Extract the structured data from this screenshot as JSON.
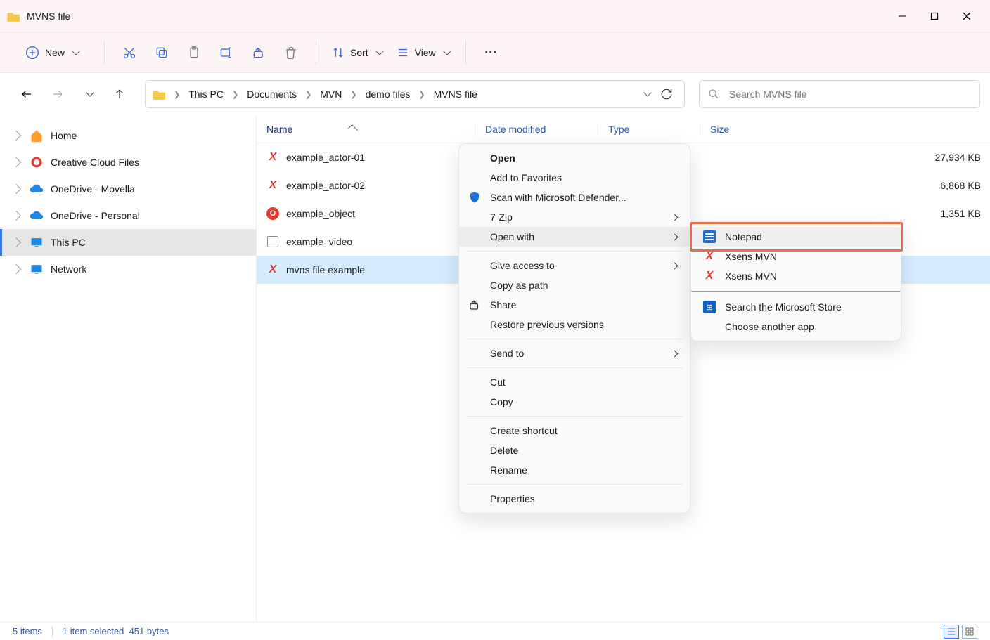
{
  "window": {
    "title": "MVNS file"
  },
  "toolbar": {
    "new_label": "New",
    "sort_label": "Sort",
    "view_label": "View"
  },
  "breadcrumbs": [
    "This PC",
    "Documents",
    "MVN",
    "demo files",
    "MVNS file"
  ],
  "search": {
    "placeholder": "Search MVNS file"
  },
  "tree": {
    "items": [
      {
        "label": "Home",
        "icon": "home"
      },
      {
        "label": "Creative Cloud Files",
        "icon": "cc"
      },
      {
        "label": "OneDrive - Movella",
        "icon": "cloud"
      },
      {
        "label": "OneDrive - Personal",
        "icon": "cloud"
      },
      {
        "label": "This PC",
        "icon": "pc",
        "selected": true
      },
      {
        "label": "Network",
        "icon": "net"
      }
    ]
  },
  "columns": {
    "name": "Name",
    "date": "Date modified",
    "type": "Type",
    "size": "Size"
  },
  "files": [
    {
      "name": "example_actor-01",
      "icon": "x",
      "size": "27,934 KB"
    },
    {
      "name": "example_actor-02",
      "icon": "x",
      "size": "6,868 KB"
    },
    {
      "name": "example_object",
      "icon": "o",
      "size": "1,351 KB"
    },
    {
      "name": "example_video",
      "icon": "v",
      "size": ""
    },
    {
      "name": "mvns file example",
      "icon": "x",
      "size": "",
      "selected": true
    }
  ],
  "context_menu": {
    "items": [
      {
        "label": "Open",
        "bold": true
      },
      {
        "label": "Add to Favorites"
      },
      {
        "label": "Scan with Microsoft Defender...",
        "icon": "shield"
      },
      {
        "label": "7-Zip",
        "arrow": true
      },
      {
        "label": "Open with",
        "arrow": true,
        "highlight": true
      },
      {
        "sep": true
      },
      {
        "label": "Give access to",
        "arrow": true
      },
      {
        "label": "Copy as path"
      },
      {
        "label": "Share",
        "icon": "share"
      },
      {
        "label": "Restore previous versions"
      },
      {
        "sep": true
      },
      {
        "label": "Send to",
        "arrow": true
      },
      {
        "sep": true
      },
      {
        "label": "Cut"
      },
      {
        "label": "Copy"
      },
      {
        "sep": true
      },
      {
        "label": "Create shortcut"
      },
      {
        "label": "Delete"
      },
      {
        "label": "Rename"
      },
      {
        "sep": true
      },
      {
        "label": "Properties"
      }
    ]
  },
  "openwith_menu": {
    "items": [
      {
        "label": "Notepad",
        "icon": "notepad",
        "highlight": true
      },
      {
        "label": "Xsens MVN",
        "icon": "x"
      },
      {
        "label": "Xsens MVN",
        "icon": "x"
      },
      {
        "sep": true
      },
      {
        "label": "Search the Microsoft Store",
        "icon": "store"
      },
      {
        "label": "Choose another app"
      }
    ]
  },
  "status": {
    "count": "5 items",
    "selection": "1 item selected",
    "bytes": "451 bytes"
  }
}
